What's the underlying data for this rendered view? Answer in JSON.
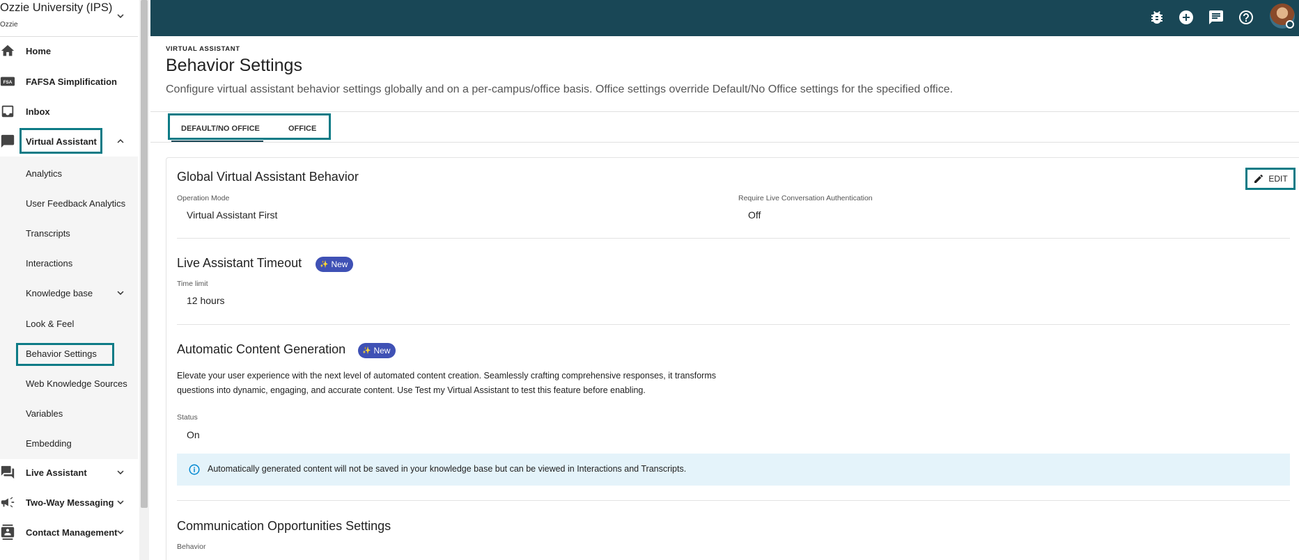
{
  "org": {
    "name": "Ozzie University (IPS)",
    "sub": "Ozzie"
  },
  "sidebar": {
    "home": "Home",
    "fafsa": "FAFSA Simplification",
    "fafsa_badge": "FSA",
    "inbox": "Inbox",
    "virtual_assistant": "Virtual Assistant",
    "submenu": {
      "analytics": "Analytics",
      "user_feedback": "User Feedback Analytics",
      "transcripts": "Transcripts",
      "interactions": "Interactions",
      "knowledge_base": "Knowledge base",
      "look_feel": "Look & Feel",
      "behavior_settings": "Behavior Settings",
      "web_knowledge": "Web Knowledge Sources",
      "variables": "Variables",
      "embedding": "Embedding"
    },
    "live_assistant": "Live Assistant",
    "two_way": "Two-Way Messaging",
    "contact_mgmt": "Contact Management"
  },
  "header": {
    "crumb": "VIRTUAL ASSISTANT",
    "title": "Behavior Settings",
    "description": "Configure virtual assistant behavior settings globally and on a per-campus/office basis. Office settings override Default/No Office settings for the specified office."
  },
  "tabs": {
    "default": "DEFAULT/NO OFFICE",
    "office": "OFFICE"
  },
  "global": {
    "title": "Global Virtual Assistant Behavior",
    "edit": "EDIT",
    "operation_mode_label": "Operation Mode",
    "operation_mode_value": "Virtual Assistant First",
    "require_auth_label": "Require Live Conversation Authentication",
    "require_auth_value": "Off"
  },
  "timeout": {
    "title": "Live Assistant Timeout",
    "badge": "New",
    "label": "Time limit",
    "value": "12 hours"
  },
  "autogen": {
    "title": "Automatic Content Generation",
    "badge": "New",
    "description": "Elevate your user experience with the next level of automated content creation. Seamlessly crafting comprehensive responses, it transforms questions into dynamic, engaging, and accurate content. Use Test my Virtual Assistant to test this feature before enabling.",
    "status_label": "Status",
    "status_value": "On",
    "info": "Automatically generated content will not be saved in your knowledge base but can be viewed in Interactions and Transcripts."
  },
  "comm": {
    "title": "Communication Opportunities Settings",
    "behavior_label": "Behavior"
  },
  "colors": {
    "topbar": "#194756",
    "highlight": "#0d7b86",
    "badge": "#3f51b5",
    "info_bg": "#e4f3fa"
  }
}
